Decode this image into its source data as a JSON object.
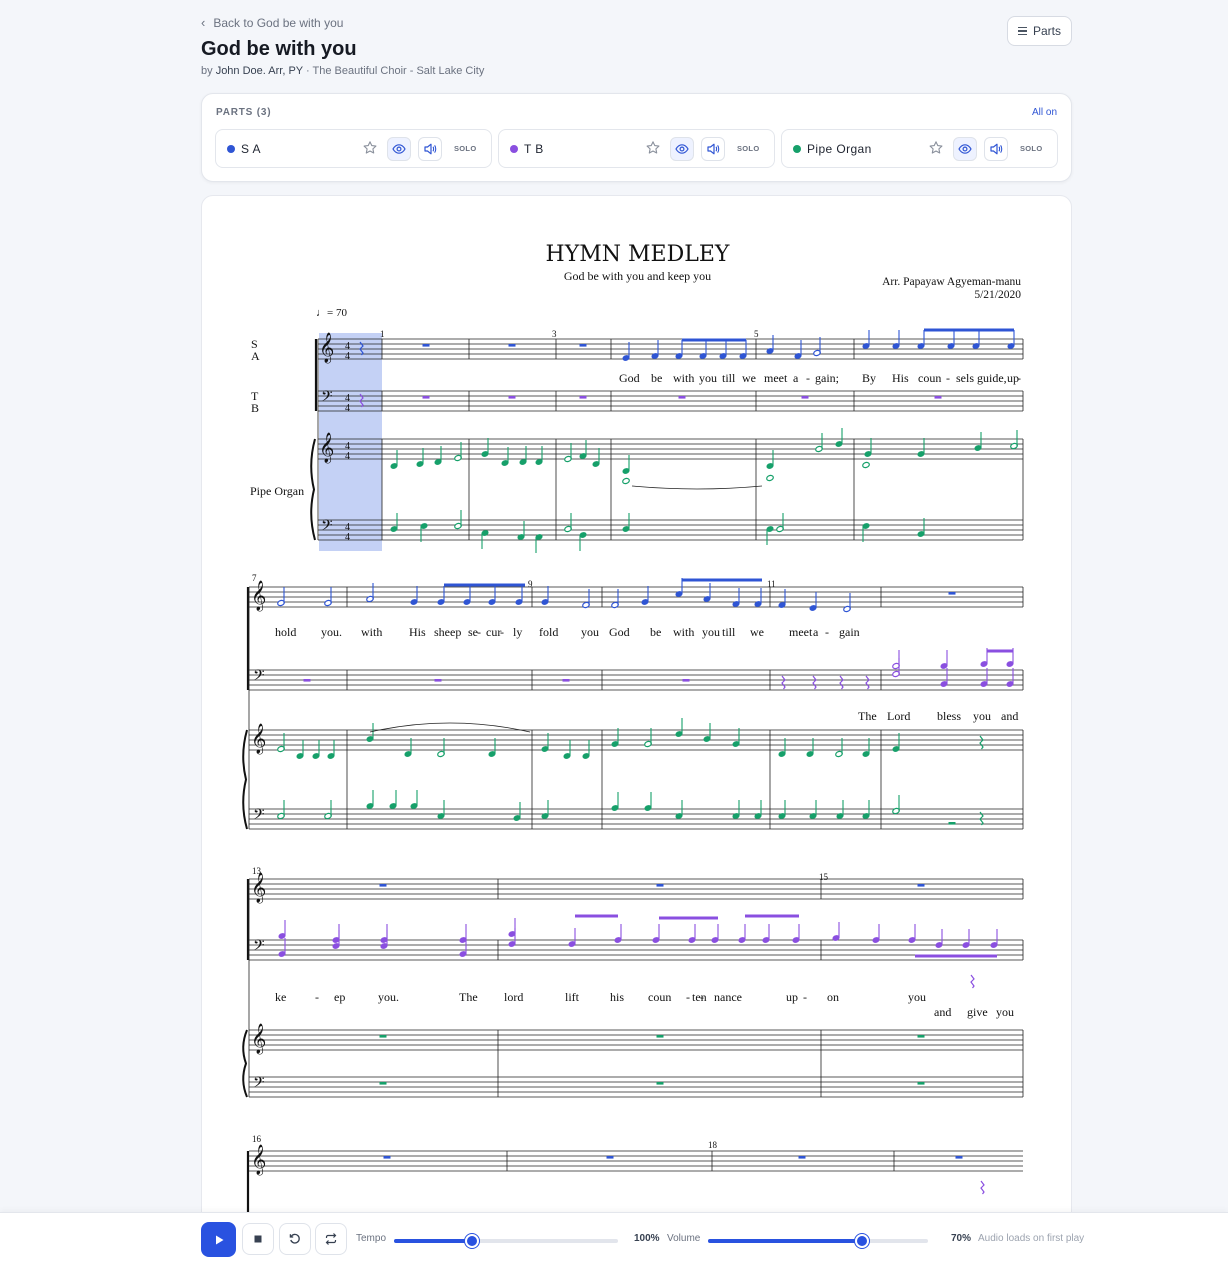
{
  "header": {
    "back_label": "Back to God be with you",
    "title": "God be with you",
    "by_prefix": "by",
    "author": "John Doe. Arr, PY",
    "choir": "· The Beautiful Choir - Salt Lake City",
    "parts_button": "Parts"
  },
  "parts_panel": {
    "heading": "PARTS (3)",
    "all_on": "All on",
    "parts": [
      {
        "name": "S A",
        "color": "#2f55d4",
        "solo": "SOLO"
      },
      {
        "name": "T B",
        "color": "#8a4fe0",
        "solo": "SOLO"
      },
      {
        "name": "Pipe Organ",
        "color": "#16a06a",
        "solo": "SOLO"
      }
    ]
  },
  "score": {
    "title": "HYMN MEDLEY",
    "subtitle": "God be with you and keep you",
    "arranger": "Arr. Papayaw Agyeman-manu",
    "date": "5/21/2020",
    "tempo": "= 70",
    "staff_labels": {
      "sa_s": "S",
      "sa_a": "A",
      "tb_t": "T",
      "tb_b": "B",
      "organ": "Pipe Organ"
    },
    "measure_numbers": {
      "m1": "1",
      "m3": "3",
      "m5": "5",
      "m7": "7",
      "m9": "9",
      "m11": "11",
      "m13": "13",
      "m15": "15",
      "m16": "16",
      "m18": "18"
    },
    "lyrics": {
      "sys1": [
        "God",
        "be",
        "with",
        "you",
        "till",
        "we",
        "meet",
        "a",
        "-",
        "gain;",
        "By",
        "His",
        "coun",
        "-",
        "sels",
        "guide,",
        "up",
        "-"
      ],
      "sys2_sa": [
        "hold",
        "you.",
        "with",
        "His",
        "sheep",
        "se",
        "-",
        "cur",
        "-",
        "ly",
        "fold",
        "you",
        "God",
        "be",
        "with",
        "you",
        "till",
        "we",
        "meet",
        "a",
        "-",
        "gain"
      ],
      "sys2_tb": [
        "The",
        "Lord",
        "bless",
        "you",
        "and"
      ],
      "sys3_a": [
        "ke",
        "-",
        "ep",
        "you.",
        "The",
        "lord",
        "lift",
        "his",
        "coun",
        "-",
        "ten",
        "-",
        "nance",
        "up",
        "-",
        "on",
        "you"
      ],
      "sys3_b": [
        "and",
        "give",
        "you"
      ]
    }
  },
  "player": {
    "tempo_label": "Tempo",
    "tempo_value": "100%",
    "tempo_level": 0.35,
    "volume_label": "Volume",
    "volume_value": "70%",
    "volume_level": 0.7,
    "hint": "Audio loads on first play"
  }
}
